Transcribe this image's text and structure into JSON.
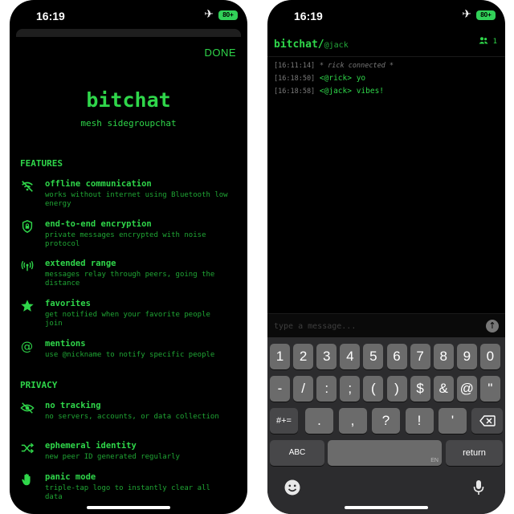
{
  "status": {
    "time": "16:19",
    "battery": "80+"
  },
  "left": {
    "done": "DONE",
    "logo": "bitchat",
    "tagline": "mesh sidegroupchat",
    "features_title": "FEATURES",
    "features": [
      {
        "icon": "wifi-off-icon",
        "title": "offline communication",
        "desc": "works without internet using Bluetooth low energy"
      },
      {
        "icon": "lock-shield-icon",
        "title": "end-to-end encryption",
        "desc": "private messages encrypted with noise protocol"
      },
      {
        "icon": "antenna-icon",
        "title": "extended range",
        "desc": "messages relay through peers, going the distance"
      },
      {
        "icon": "star-icon",
        "title": "favorites",
        "desc": "get notified when your favorite people join"
      },
      {
        "icon": "at-icon",
        "title": "mentions",
        "desc": "use @nickname to notify specific people"
      }
    ],
    "privacy_title": "PRIVACY",
    "privacy": [
      {
        "icon": "eye-slash-icon",
        "title": "no tracking",
        "desc": "no servers, accounts, or data collection"
      },
      {
        "icon": "shuffle-icon",
        "title": "ephemeral identity",
        "desc": "new peer ID generated regularly"
      },
      {
        "icon": "hand-icon",
        "title": "panic mode",
        "desc": "triple-tap logo to instantly clear all data"
      }
    ]
  },
  "right": {
    "app": "bitchat/",
    "nick": "@jack",
    "peer_count": "1",
    "messages": [
      {
        "ts": "[16:11:14]",
        "system": "* rick connected *"
      },
      {
        "ts": "[16:18:50]",
        "nick": "<@rick>",
        "text": "yo"
      },
      {
        "ts": "[16:18:58]",
        "nick": "<@jack>",
        "text": "vibes!"
      }
    ],
    "input_placeholder": "type a message...",
    "keyboard": {
      "row1": [
        "1",
        "2",
        "3",
        "4",
        "5",
        "6",
        "7",
        "8",
        "9",
        "0"
      ],
      "row2": [
        "-",
        "/",
        ":",
        ";",
        "(",
        ")",
        "$",
        "&",
        "@",
        "\""
      ],
      "symbol_toggle": "#+=",
      "row3": [
        ".",
        ",",
        "?",
        "!",
        "'"
      ],
      "abc": "ABC",
      "return": "return",
      "space_hint": "EN"
    }
  }
}
